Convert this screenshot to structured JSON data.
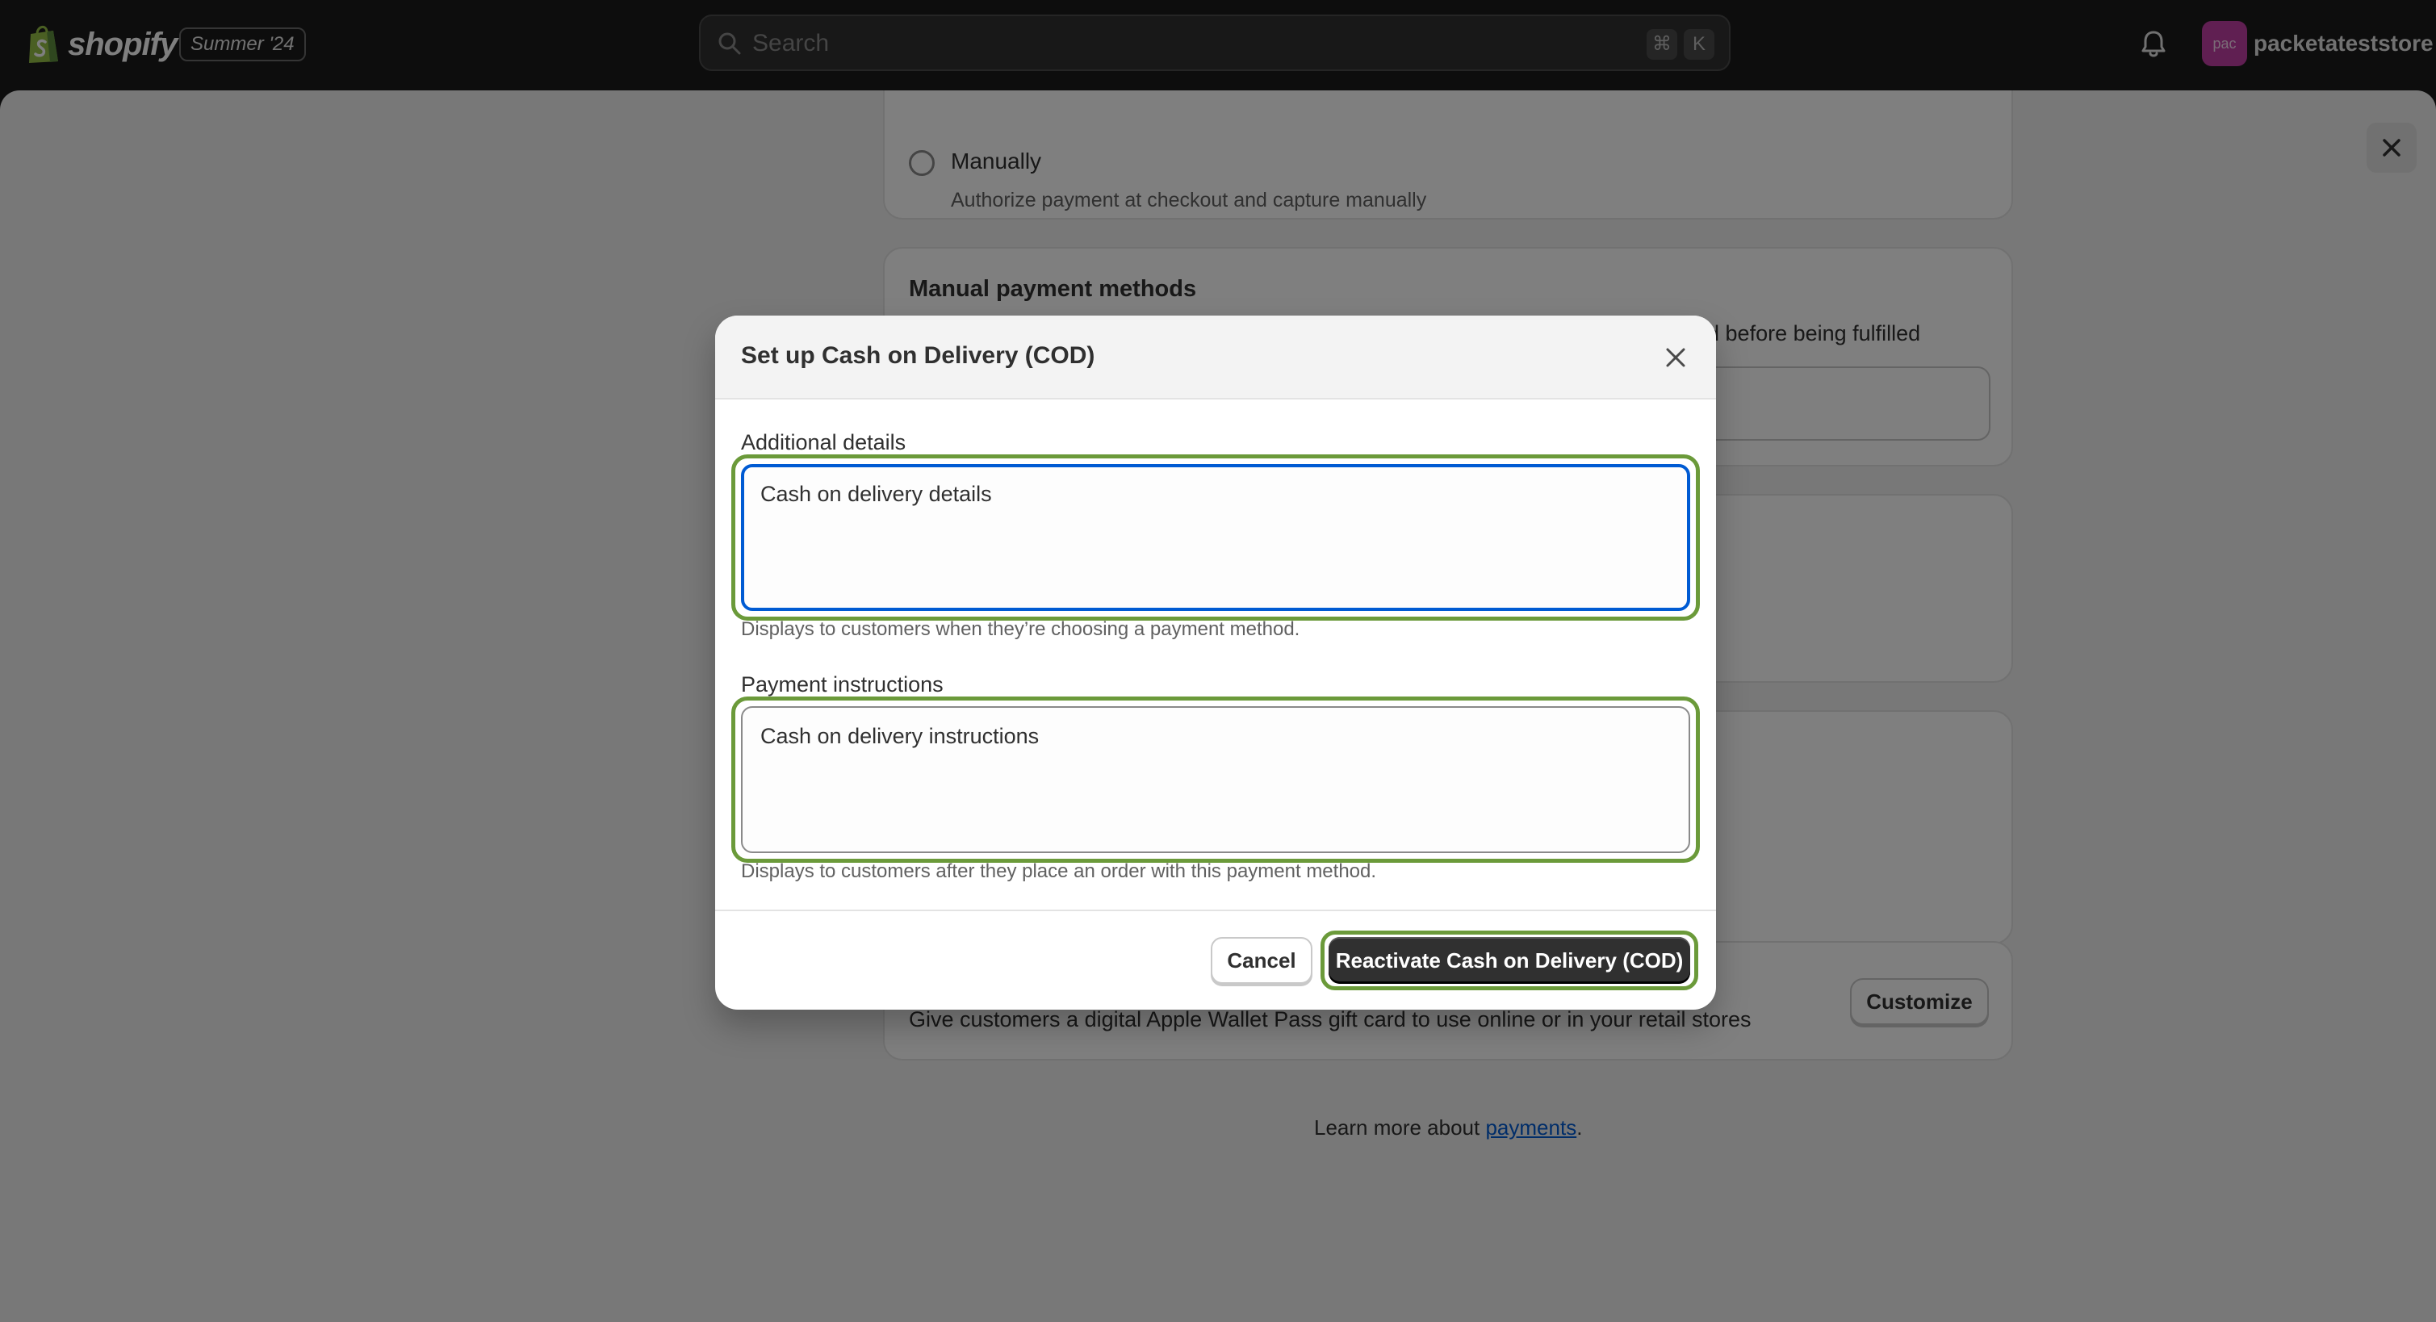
{
  "topbar": {
    "brand": "shopify",
    "edition": "Summer '24",
    "search_placeholder": "Search",
    "shortcut_cmd": "⌘",
    "shortcut_key": "K",
    "avatar_initials": "pac",
    "store_name": "packetateststore"
  },
  "background": {
    "capture": {
      "option_label": "Manually",
      "option_desc": "Authorize payment at checkout and capture manually"
    },
    "manual_methods": {
      "title": "Manual payment methods",
      "desc_fragment": "ed before being fulfilled"
    },
    "gift_card": {
      "desc": "Give customers a digital Apple Wallet Pass gift card to use online or in your retail stores",
      "customize_label": "Customize"
    },
    "footer": {
      "learn_prefix": "Learn more about ",
      "learn_link": "payments",
      "learn_suffix": "."
    }
  },
  "modal": {
    "title": "Set up Cash on Delivery (COD)",
    "additional_details": {
      "label": "Additional details",
      "value": "Cash on delivery details",
      "help": "Displays to customers when they’re choosing a payment method."
    },
    "payment_instructions": {
      "label": "Payment instructions",
      "value": "Cash on delivery instructions",
      "help": "Displays to customers after they place an order with this payment method."
    },
    "cancel_label": "Cancel",
    "primary_label": "Reactivate Cash on Delivery (COD)"
  },
  "colors": {
    "topbar_bg": "#1a1a1a",
    "primary_button": "#303030",
    "focus_ring": "#005bd3",
    "highlight": "#6b9a3a",
    "avatar_bg": "#c13fa4"
  }
}
